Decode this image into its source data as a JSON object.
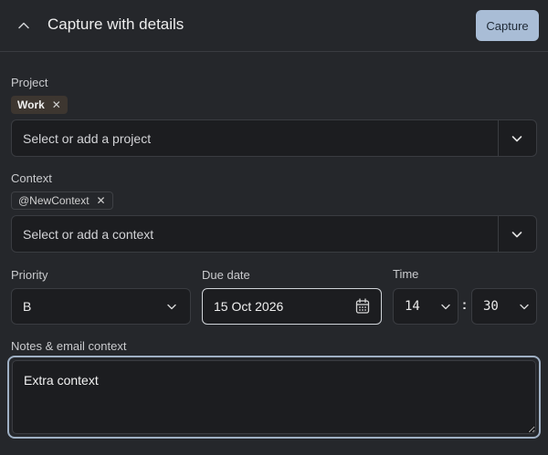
{
  "header": {
    "title": "Capture with details",
    "capture_label": "Capture"
  },
  "project": {
    "label": "Project",
    "chip": "Work",
    "placeholder": "Select or add a project"
  },
  "context": {
    "label": "Context",
    "chip": "@NewContext",
    "placeholder": "Select or add a context"
  },
  "priority": {
    "label": "Priority",
    "value": "B"
  },
  "due_date": {
    "label": "Due date",
    "value": "15 Oct 2026"
  },
  "time": {
    "label": "Time",
    "hour": "14",
    "separator": ":",
    "minute": "30"
  },
  "notes": {
    "label": "Notes & email context",
    "value": "Extra context"
  },
  "icons": {
    "collapse": "chevron-up-icon",
    "dropdown": "chevron-down-icon",
    "remove": "close-icon",
    "calendar": "calendar-icon"
  },
  "colors": {
    "background": "#25272b",
    "field": "#1c1d20",
    "primary_button": "#a9bdd6",
    "project_chip": "#3d3630",
    "focus_ring": "#9fb0c4"
  }
}
